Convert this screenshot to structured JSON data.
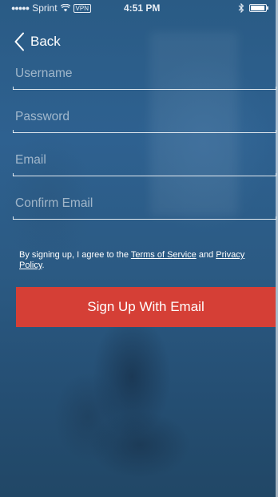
{
  "status_bar": {
    "carrier": "Sprint",
    "vpn": "VPN",
    "time": "4:51 PM"
  },
  "nav": {
    "back_label": "Back",
    "back_icon": "chevron-left-icon"
  },
  "form": {
    "username": {
      "placeholder": "Username",
      "value": ""
    },
    "password": {
      "placeholder": "Password",
      "value": ""
    },
    "email": {
      "placeholder": "Email",
      "value": ""
    },
    "confirm_email": {
      "placeholder": "Confirm Email",
      "value": ""
    }
  },
  "terms": {
    "prefix": "By signing up, I agree to the ",
    "terms_link": "Terms of Service",
    "middle": " and ",
    "privacy_link": "Privacy Policy",
    "suffix": "."
  },
  "signup_button": {
    "label": "Sign Up With Email"
  },
  "colors": {
    "background": "#2f5f86",
    "button": "#d53f36",
    "text": "#ffffff"
  }
}
